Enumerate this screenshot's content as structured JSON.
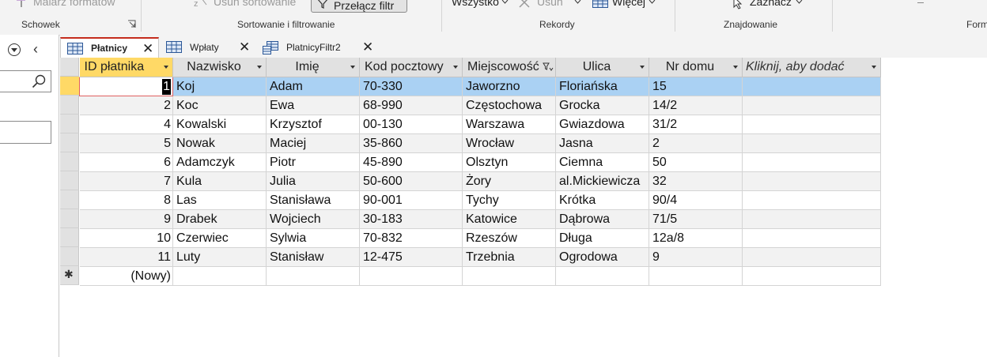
{
  "ribbon": {
    "painter_label": "Malarz formatów",
    "remove_sort_label": "Usuń sortowanie",
    "toggle_filter_label": "Przełącz filtr",
    "all_label": "Wszystko",
    "delete_label": "Usuń",
    "more_label": "Więcej",
    "select_label": "Zaznacz",
    "groups": {
      "clipboard": "Schowek",
      "sort_filter": "Sortowanie i filtrowanie",
      "records": "Rekordy",
      "find": "Znajdowanie",
      "form": "Form"
    }
  },
  "tabs": [
    {
      "label": "Płatnicy",
      "active": true
    },
    {
      "label": "Wpłaty",
      "active": false
    },
    {
      "label": "PlatnicyFiltr2",
      "active": false
    }
  ],
  "columns": [
    "ID płatnika",
    "Nazwisko",
    "Imię",
    "Kod pocztowy",
    "Miejscowość",
    "Ulica",
    "Nr domu",
    "Kliknij, aby dodać"
  ],
  "rows": [
    {
      "id": "1",
      "nazwisko": "Koj",
      "imie": "Adam",
      "kod": "70-330",
      "miejscowosc": "Jaworzno",
      "ulica": "Floriańska",
      "nr": "15"
    },
    {
      "id": "2",
      "nazwisko": "Koc",
      "imie": "Ewa",
      "kod": "68-990",
      "miejscowosc": "Częstochowa",
      "ulica": "Grocka",
      "nr": "14/2"
    },
    {
      "id": "4",
      "nazwisko": "Kowalski",
      "imie": "Krzysztof",
      "kod": "00-130",
      "miejscowosc": "Warszawa",
      "ulica": "Gwiazdowa",
      "nr": "31/2"
    },
    {
      "id": "5",
      "nazwisko": "Nowak",
      "imie": "Maciej",
      "kod": "35-860",
      "miejscowosc": "Wrocław",
      "ulica": "Jasna",
      "nr": "2"
    },
    {
      "id": "6",
      "nazwisko": "Adamczyk",
      "imie": "Piotr",
      "kod": "45-890",
      "miejscowosc": "Olsztyn",
      "ulica": "Ciemna",
      "nr": "50"
    },
    {
      "id": "7",
      "nazwisko": "Kula",
      "imie": "Julia",
      "kod": "50-600",
      "miejscowosc": "Żory",
      "ulica": "al.Mickiewicza",
      "nr": "32"
    },
    {
      "id": "8",
      "nazwisko": "Las",
      "imie": "Stanisława",
      "kod": "90-001",
      "miejscowosc": "Tychy",
      "ulica": "Krótka",
      "nr": "90/4"
    },
    {
      "id": "9",
      "nazwisko": "Drabek",
      "imie": "Wojciech",
      "kod": "30-183",
      "miejscowosc": "Katowice",
      "ulica": "Dąbrowa",
      "nr": "71/5"
    },
    {
      "id": "10",
      "nazwisko": "Czerwiec",
      "imie": "Sylwia",
      "kod": "70-832",
      "miejscowosc": "Rzeszów",
      "ulica": "Długa",
      "nr": "12a/8"
    },
    {
      "id": "11",
      "nazwisko": "Luty",
      "imie": "Stanisław",
      "kod": "12-475",
      "miejscowosc": "Trzebnia",
      "ulica": "Ogrodowa",
      "nr": "9"
    }
  ],
  "new_row_label": "(Nowy)",
  "colors": {
    "accent_tab": "#c42b1c",
    "selected_row": "#aad1f3",
    "active_header": "#ffd966"
  }
}
